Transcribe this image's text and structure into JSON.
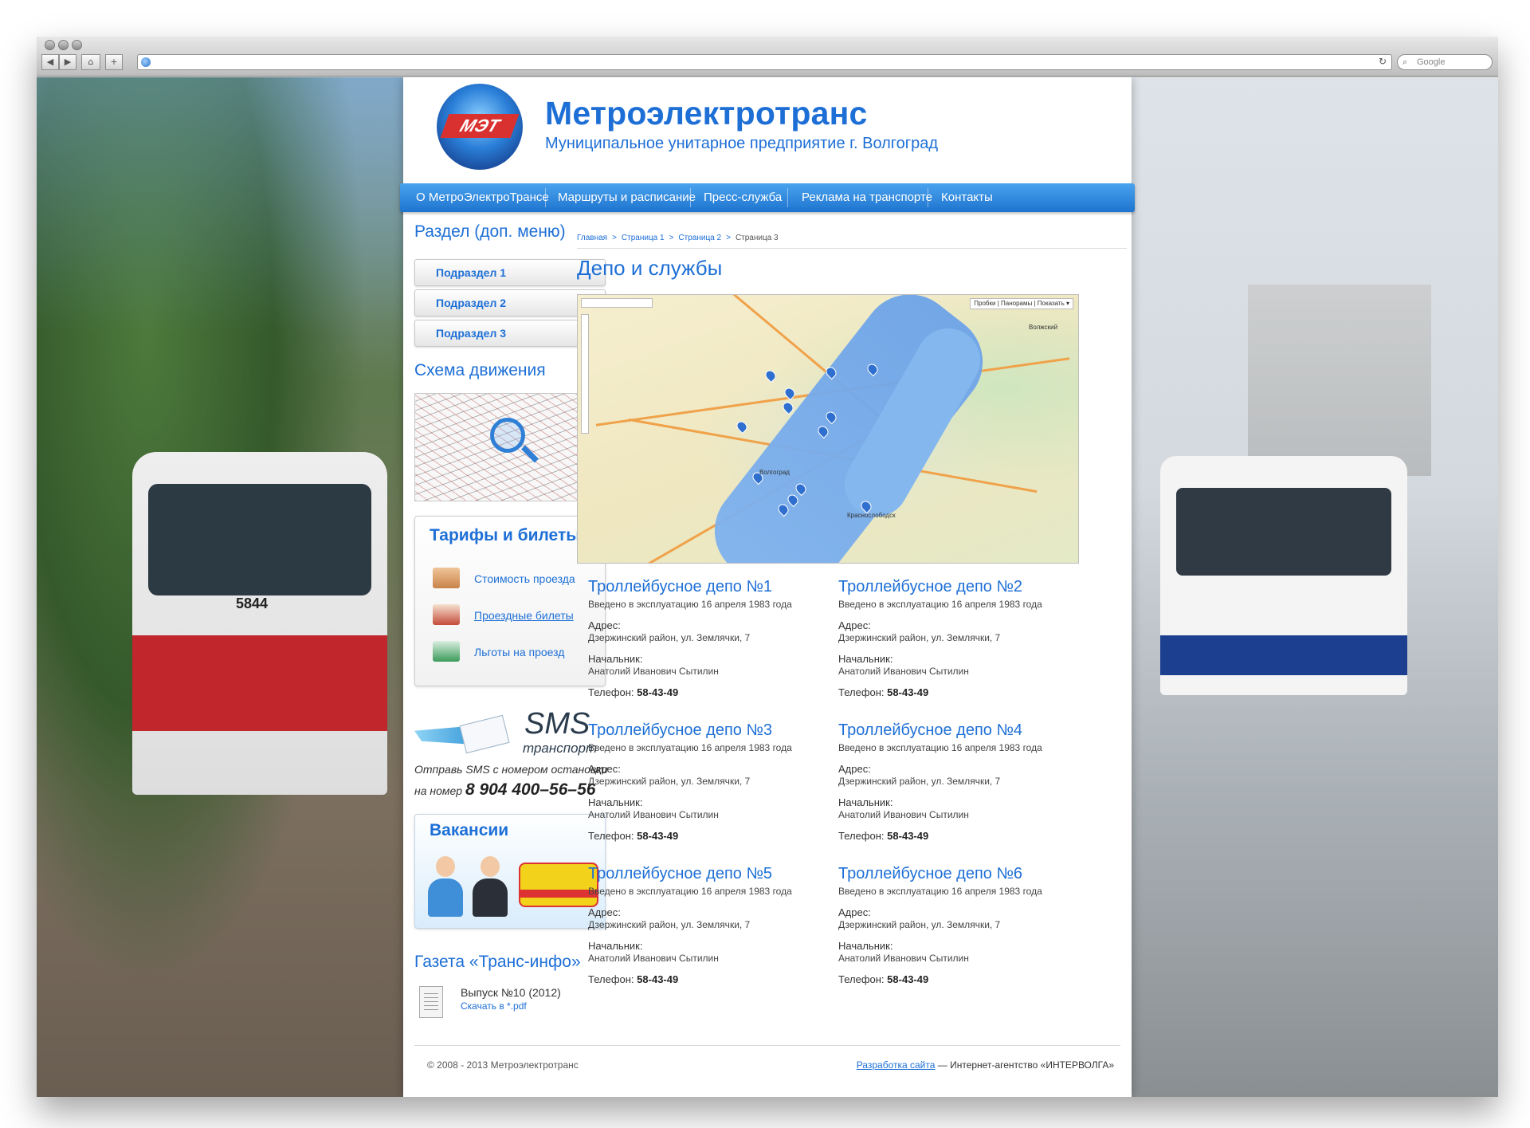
{
  "browser": {
    "search_placeholder": "Google"
  },
  "header": {
    "title": "Метроэлектротранс",
    "subtitle": "Муниципальное унитарное предприятие г. Волгоград",
    "logo_text": "МЭТ"
  },
  "menu": {
    "items": [
      {
        "label": "О МетроЭлектроТрансе"
      },
      {
        "label": "Маршруты и расписание"
      },
      {
        "label": "Пресс-служба"
      },
      {
        "label": "Реклама на транспорте"
      },
      {
        "label": "Контакты"
      }
    ]
  },
  "sidebar": {
    "section_title": "Раздел (доп. меню)",
    "subsections": [
      "Подраздел 1",
      "Подраздел 2",
      "Подраздел 3"
    ],
    "scheme_title": "Схема движения",
    "tariffs": {
      "title": "Тарифы и билеты",
      "links": [
        "Стоимость проезда",
        "Проездные билеты",
        "Льготы на проезд"
      ]
    },
    "sms": {
      "big": "SMS",
      "small": "транспорт",
      "line1": "Отправь SMS с номером остановки",
      "line2_prefix": "на номер",
      "number": "8 904 400–56–56"
    },
    "vacancies_title": "Вакансии",
    "newspaper": {
      "title": "Газета «Транс-инфо»",
      "issue": "Выпуск №10 (2012)",
      "download": "Скачать в *.pdf"
    }
  },
  "breadcrumb": {
    "items": [
      "Главная",
      "Страница 1",
      "Страница 2"
    ],
    "current": "Страница 3",
    "separator": ">"
  },
  "page": {
    "title": "Депо и службы"
  },
  "map": {
    "controls": "Пробки | Панорамы | Показать ▾",
    "labels": [
      "Волгоград",
      "Краснослободск",
      "Волжский"
    ]
  },
  "depots": [
    {
      "title": "Троллейбусное депо №1",
      "intro": "Введено в эксплуатацию 16 апреля 1983 года",
      "address_label": "Адрес:",
      "address": "Дзержинский район, ул. Землячки, 7",
      "chief_label": "Начальник:",
      "chief": "Анатолий Иванович Сытилин",
      "phone_label": "Телефон:",
      "phone": "58-43-49"
    },
    {
      "title": "Троллейбусное депо №2",
      "intro": "Введено в эксплуатацию 16 апреля 1983 года",
      "address_label": "Адрес:",
      "address": "Дзержинский район, ул. Землячки, 7",
      "chief_label": "Начальник:",
      "chief": "Анатолий Иванович Сытилин",
      "phone_label": "Телефон:",
      "phone": "58-43-49"
    },
    {
      "title": "Троллейбусное депо №3",
      "intro": "Введено в эксплуатацию 16 апреля 1983 года",
      "address_label": "Адрес:",
      "address": "Дзержинский район, ул. Землячки, 7",
      "chief_label": "Начальник:",
      "chief": "Анатолий Иванович Сытилин",
      "phone_label": "Телефон:",
      "phone": "58-43-49"
    },
    {
      "title": "Троллейбусное депо №4",
      "intro": "Введено в эксплуатацию 16 апреля 1983 года",
      "address_label": "Адрес:",
      "address": "Дзержинский район, ул. Землячки, 7",
      "chief_label": "Начальник:",
      "chief": "Анатолий Иванович Сытилин",
      "phone_label": "Телефон:",
      "phone": "58-43-49"
    },
    {
      "title": "Троллейбусное депо №5",
      "intro": "Введено в эксплуатацию 16 апреля 1983 года",
      "address_label": "Адрес:",
      "address": "Дзержинский район, ул. Землячки, 7",
      "chief_label": "Начальник:",
      "chief": "Анатолий Иванович Сытилин",
      "phone_label": "Телефон:",
      "phone": "58-43-49"
    },
    {
      "title": "Троллейбусное депо №6",
      "intro": "Введено в эксплуатацию 16 апреля 1983 года",
      "address_label": "Адрес:",
      "address": "Дзержинский район, ул. Землячки, 7",
      "chief_label": "Начальник:",
      "chief": "Анатолий Иванович Сытилин",
      "phone_label": "Телефон:",
      "phone": "58-43-49"
    }
  ],
  "footer": {
    "copyright": "© 2008 - 2013 Метроэлектротранс",
    "dev_link": "Разработка сайта",
    "dev_text": " — Интернет-агентство «ИНТЕРВОЛГА»"
  },
  "colors": {
    "accent": "#1d6fd6",
    "menu": "#2a84dc"
  }
}
